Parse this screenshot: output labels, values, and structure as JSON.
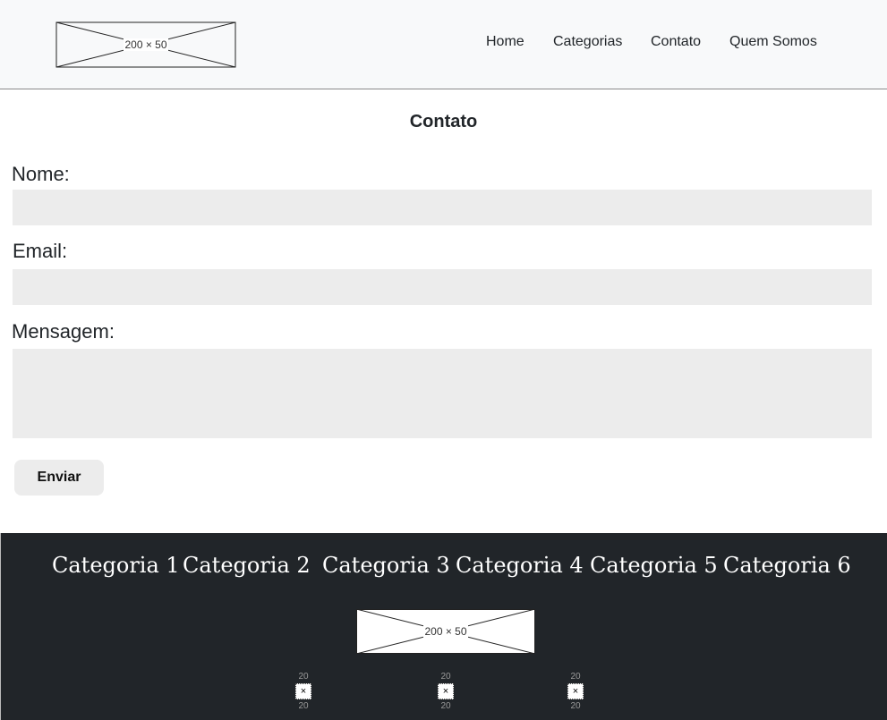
{
  "header": {
    "logo_placeholder": "200 × 50",
    "nav": [
      "Home",
      "Categorias",
      "Contato",
      "Quem Somos"
    ]
  },
  "form": {
    "title": "Contato",
    "name_label": "Nome:",
    "email_label": "Email:",
    "message_label": "Mensagem:",
    "name_value": "",
    "email_value": "",
    "message_value": "",
    "submit_label": "Enviar"
  },
  "footer": {
    "categories": [
      "Categoria 1",
      "Categoria 2",
      "Categoria 3",
      "Categoria 4",
      "Categoria 5",
      "Categoria 6"
    ],
    "logo_placeholder": "200 × 50",
    "social_icons": [
      {
        "top": "20",
        "bottom": "20",
        "glyph": "×"
      },
      {
        "top": "20",
        "bottom": "20",
        "glyph": "×"
      },
      {
        "top": "20",
        "bottom": "20",
        "glyph": "×"
      }
    ]
  },
  "colors": {
    "navbar_bg": "#f8f9fa",
    "footer_bg": "#212529",
    "input_bg": "#ececec"
  }
}
